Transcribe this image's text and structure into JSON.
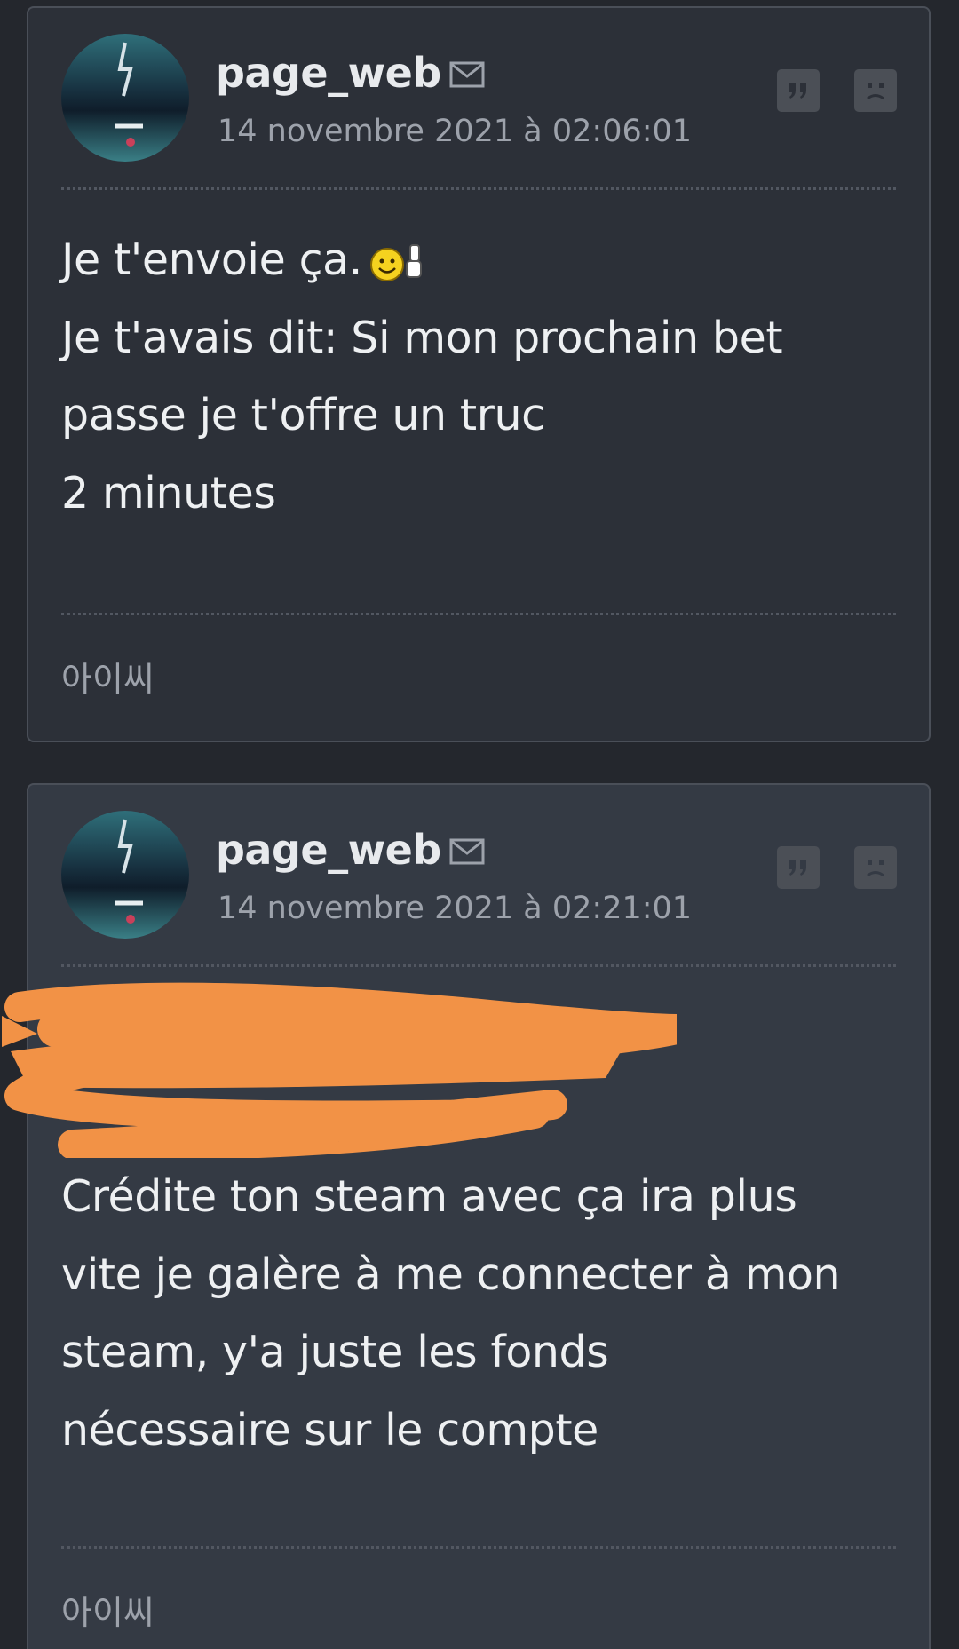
{
  "posts": [
    {
      "author": "page_web",
      "timestamp": "14 novembre 2021 à 02:06:01",
      "lines": [
        "Je t'envoie ça.",
        "Je t'avais dit: Si mon prochain bet",
        "passe je t'offre un truc",
        "2 minutes"
      ],
      "emoji": "smiley-thumbs-up",
      "signature": "아이씨"
    },
    {
      "author": "page_web",
      "timestamp": "14 novembre 2021 à 02:21:01",
      "lines": [
        "Crédite ton steam avec ça ira plus",
        "vite je galère à me connecter à mon",
        "steam, y'a juste les fonds",
        "nécessaire sur le compte"
      ],
      "redacted_color": "#f29246",
      "signature": "아이씨"
    }
  ],
  "icons": {
    "mail": "mail-icon",
    "quote": "quote-icon",
    "sad": "sad-face-icon"
  },
  "colors": {
    "background": "#24272d",
    "card_1": "#2c3038",
    "card_2": "#343a44",
    "text": "#eef0f2",
    "muted": "#9da2ab",
    "redaction": "#f29246"
  }
}
